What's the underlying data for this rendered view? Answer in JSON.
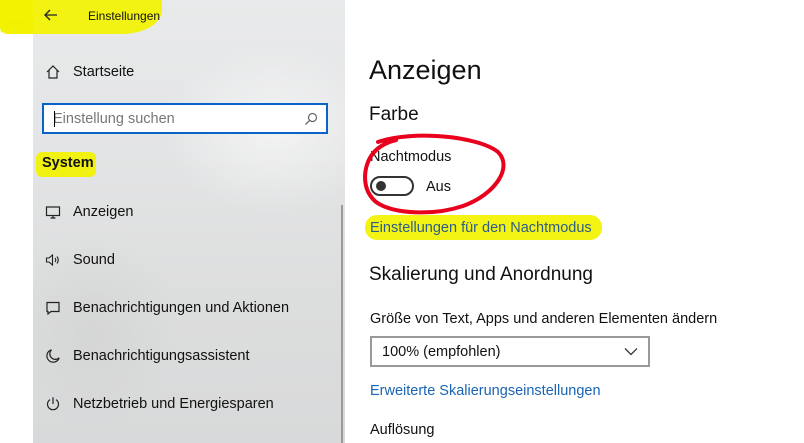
{
  "app": {
    "title": "Einstellungen"
  },
  "sidebar": {
    "home_label": "Startseite",
    "search": {
      "placeholder": "Einstellung suchen",
      "value": ""
    },
    "section_label": "System",
    "items": [
      {
        "label": "Anzeigen",
        "icon": "monitor-icon"
      },
      {
        "label": "Sound",
        "icon": "speaker-icon"
      },
      {
        "label": "Benachrichtigungen und Aktionen",
        "icon": "notification-icon"
      },
      {
        "label": "Benachrichtigungsassistent",
        "icon": "moon-icon"
      },
      {
        "label": "Netzbetrieb und Energiesparen",
        "icon": "power-icon"
      }
    ]
  },
  "main": {
    "title": "Anzeigen",
    "color_section": {
      "heading": "Farbe",
      "night_mode_label": "Nachtmodus",
      "night_mode_state": "Aus",
      "night_mode_on": false,
      "night_settings_link": "Einstellungen für den Nachtmodus"
    },
    "scale_section": {
      "heading": "Skalierung und Anordnung",
      "size_label": "Größe von Text, Apps und anderen Elementen ändern",
      "size_value": "100% (empfohlen)",
      "advanced_link": "Erweiterte Skalierungseinstellungen",
      "resolution_label": "Auflösung"
    }
  },
  "colors": {
    "accent": "#0a64c8",
    "highlight": "#f2f200",
    "annotation_red": "#e8001c",
    "sidebar_bg": "#e3e4e5"
  }
}
